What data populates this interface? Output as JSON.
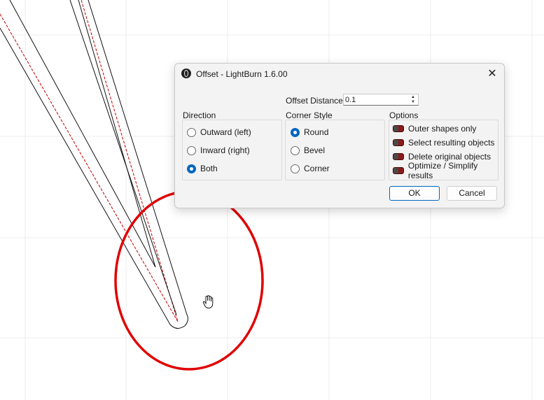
{
  "dialog": {
    "title": "Offset - LightBurn 1.6.00",
    "close_glyph": "✕",
    "app_icon": "lightburn-logo-icon"
  },
  "offset_distance": {
    "label": "Offset Distance",
    "value": "0.1",
    "spin_up": "▲",
    "spin_down": "▼"
  },
  "direction": {
    "title": "Direction",
    "options": [
      {
        "label": "Outward (left)",
        "checked": false
      },
      {
        "label": "Inward (right)",
        "checked": false
      },
      {
        "label": "Both",
        "checked": true
      }
    ]
  },
  "corner_style": {
    "title": "Corner Style",
    "options": [
      {
        "label": "Round",
        "checked": true
      },
      {
        "label": "Bevel",
        "checked": false
      },
      {
        "label": "Corner",
        "checked": false
      }
    ]
  },
  "options": {
    "title": "Options",
    "items": [
      {
        "label": "Outer shapes only",
        "checked": false
      },
      {
        "label": "Select resulting objects",
        "checked": false
      },
      {
        "label": "Delete original objects",
        "checked": false
      },
      {
        "label": "Optimize / Simplify results",
        "checked": false
      }
    ]
  },
  "buttons": {
    "ok": "OK",
    "cancel": "Cancel"
  },
  "colors": {
    "annotation_red": "#e00000",
    "path_red": "#c00000",
    "accent_blue": "#0067c0",
    "toggle_red": "#8b1a1a"
  },
  "cursor_icon": "hand-cursor-icon"
}
